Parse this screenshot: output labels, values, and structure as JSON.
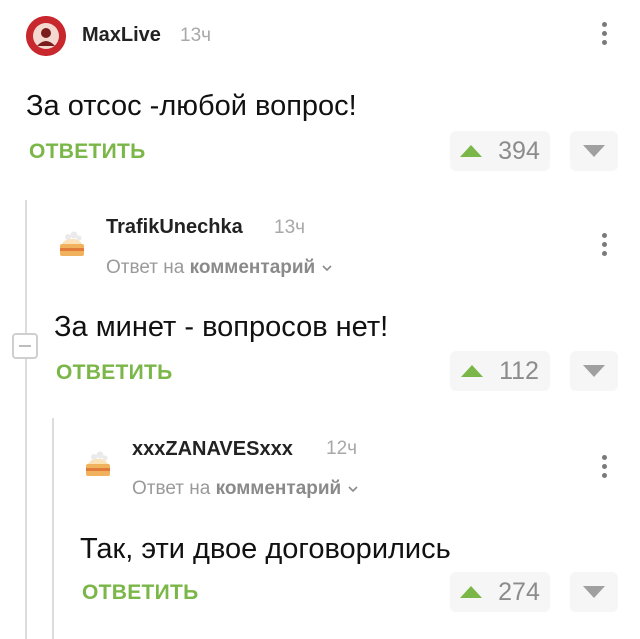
{
  "comments": [
    {
      "username": "MaxLive",
      "time": "13ч",
      "text": "За отсос -любой вопрос!",
      "reply_label": "ОТВЕТИТЬ",
      "score": "394",
      "avatar_icon": "red-round-avatar"
    },
    {
      "username": "TrafikUnechka",
      "time": "13ч",
      "reply_prefix": "Ответ на",
      "reply_target": "комментарий",
      "text": "За минет - вопросов нет!",
      "reply_label": "ОТВЕТИТЬ",
      "score": "112",
      "avatar_icon": "cake-avatar"
    },
    {
      "username": "xxxZANAVESxxx",
      "time": "12ч",
      "reply_prefix": "Ответ на",
      "reply_target": "комментарий",
      "text": "Так, эти двое договорились",
      "reply_label": "ОТВЕТИТЬ",
      "score": "274",
      "avatar_icon": "cake-avatar"
    }
  ],
  "colors": {
    "accent_green": "#7ab648",
    "avatar_red": "#c8272d",
    "muted_gray": "#a8a8a8"
  }
}
